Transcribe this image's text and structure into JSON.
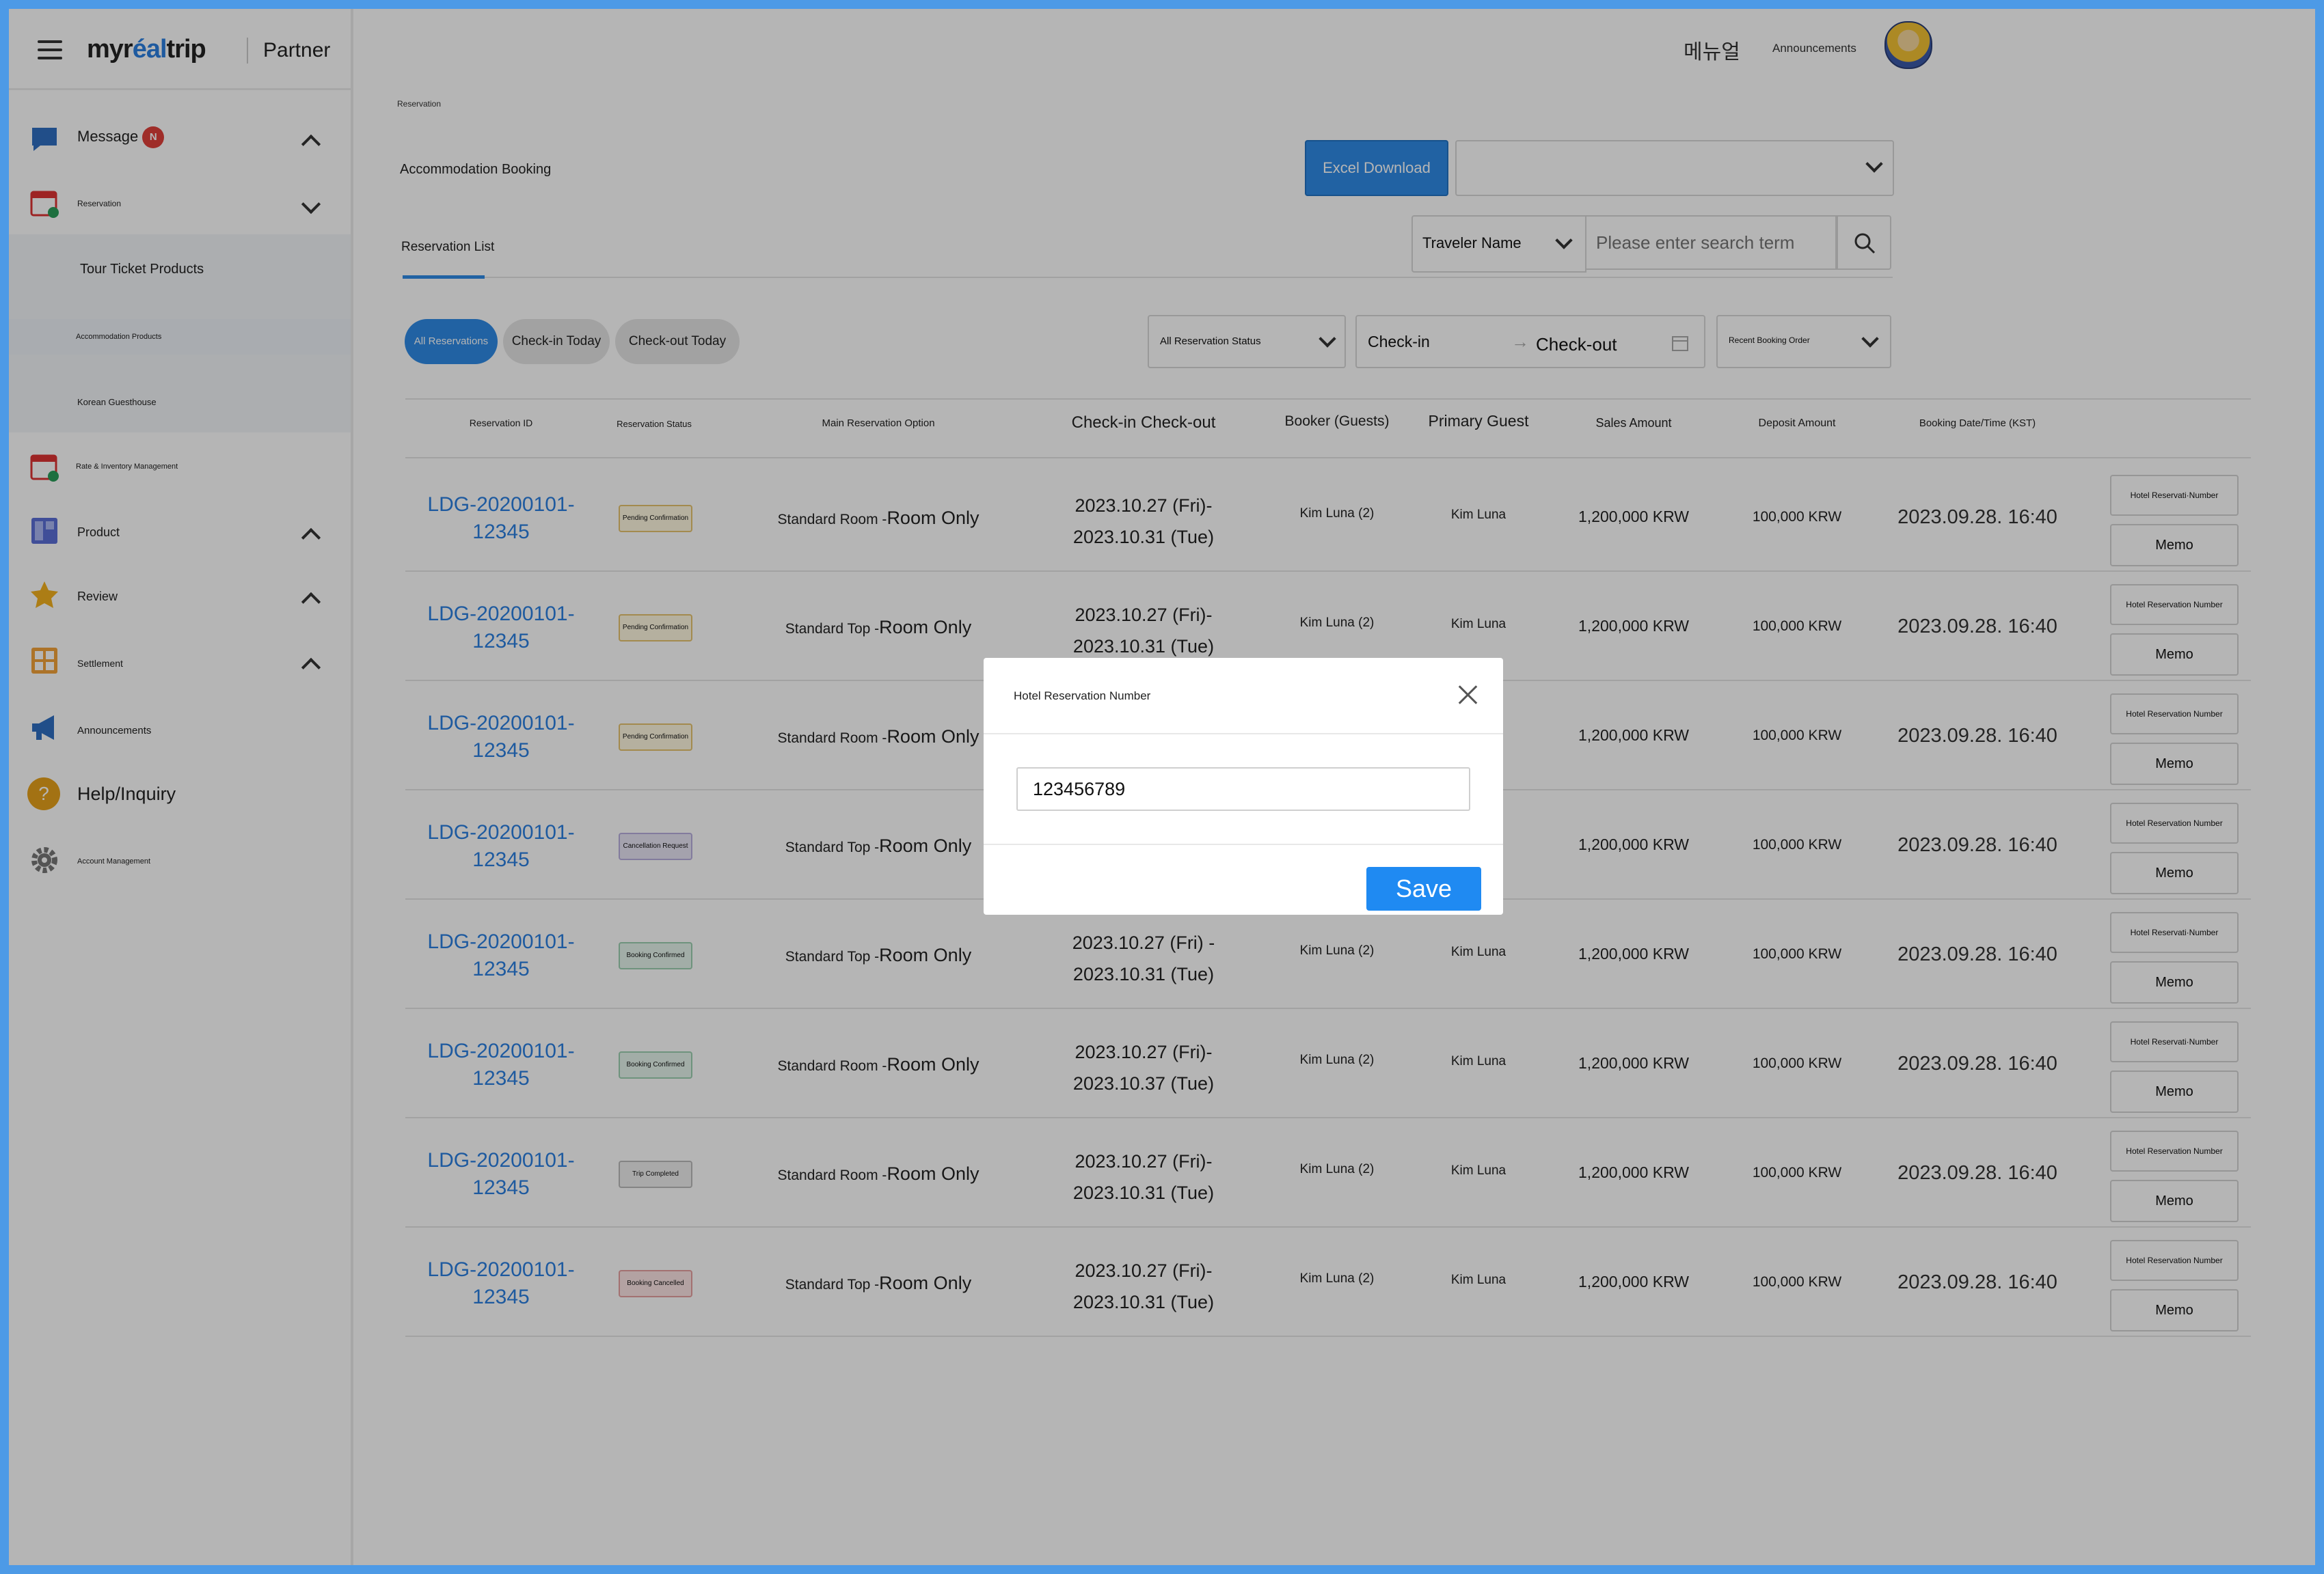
{
  "brand": {
    "logo_left": "myr",
    "logo_accent": "éal",
    "logo_right": "trip",
    "partner": "Partner"
  },
  "header": {
    "lang": "메뉴얼",
    "announcements": "Announcements"
  },
  "sidebar": {
    "message": "Message",
    "message_badge": "N",
    "reservation": "Reservation",
    "sub_items": [
      "Tour Ticket Products",
      "Accommodation Products",
      "Korean Guesthouse"
    ],
    "rate_inventory": "Rate & Inventory Management",
    "product": "Product",
    "review": "Review",
    "settlement": "Settlement",
    "announcements": "Announcements",
    "help": "Help/Inquiry",
    "account": "Account Management"
  },
  "page": {
    "breadcrumb": "Reservation",
    "title": "Accommodation Booking",
    "excel_download": "Excel Download",
    "tab": "Reservation List",
    "search_type": "Traveler Name",
    "search_placeholder": "Please enter search term"
  },
  "filters": {
    "pills": [
      "All Reservations",
      "Check-in Today",
      "Check-out Today"
    ],
    "status_select": "All Reservation Status",
    "checkin": "Check-in",
    "arrow": "→",
    "checkout": "Check-out",
    "sort_select": "Recent Booking Order"
  },
  "table": {
    "headers": [
      "Reservation ID",
      "Reservation Status",
      "Main Reservation Option",
      "Check-in Check-out",
      "Booker (Guests)",
      "Primary Guest",
      "Sales Amount",
      "Deposit Amount",
      "Booking Date/Time (KST)"
    ],
    "rows": [
      {
        "id1": "LDG-20200101-",
        "id2": "12345",
        "status": "Pending Confirmation",
        "opt_a": "Standard Room -",
        "opt_b": "Room Only",
        "d1": "2023.10.27 (Fri)-",
        "d2": "2023.10.31 (Tue)",
        "booker": "Kim Luna (2)",
        "guest": "Kim Luna",
        "sales": "1,200,000 KRW",
        "deposit": "100,000 KRW",
        "booked": "2023.09.28. 16:40",
        "hotel_btn": "Hotel Reservati·Number",
        "memo": "Memo"
      },
      {
        "id1": "LDG-20200101-",
        "id2": "12345",
        "status": "Pending Confirmation",
        "opt_a": "Standard Top -",
        "opt_b": "Room Only",
        "d1": "2023.10.27 (Fri)-",
        "d2": "2023.10.31 (Tue)",
        "booker": "Kim Luna (2)",
        "guest": "Kim Luna",
        "sales": "1,200,000 KRW",
        "deposit": "100,000 KRW",
        "booked": "2023.09.28. 16:40",
        "hotel_btn": "Hotel Reservation Number",
        "memo": "Memo"
      },
      {
        "id1": "LDG-20200101-",
        "id2": "12345",
        "status": "Pending Confirmation",
        "opt_a": "Standard Room -",
        "opt_b": "Room Only",
        "d1": "",
        "d2": "",
        "booker": "",
        "guest": "",
        "sales": "1,200,000 KRW",
        "deposit": "100,000 KRW",
        "booked": "2023.09.28. 16:40",
        "hotel_btn": "Hotel Reservation Number",
        "memo": "Memo"
      },
      {
        "id1": "LDG-20200101-",
        "id2": "12345",
        "status": "Cancellation Request",
        "opt_a": "Standard Top -",
        "opt_b": "Room Only",
        "d1": "",
        "d2": "",
        "booker": "",
        "guest": "",
        "sales": "1,200,000 KRW",
        "deposit": "100,000 KRW",
        "booked": "2023.09.28. 16:40",
        "hotel_btn": "Hotel Reservation Number",
        "memo": "Memo"
      },
      {
        "id1": "LDG-20200101-",
        "id2": "12345",
        "status": "Booking Confirmed",
        "opt_a": "Standard Top -",
        "opt_b": "Room Only",
        "d1": "2023.10.27 (Fri) -",
        "d2": "2023.10.31 (Tue)",
        "booker": "Kim Luna (2)",
        "guest": "Kim Luna",
        "sales": "1,200,000 KRW",
        "deposit": "100,000 KRW",
        "booked": "2023.09.28. 16:40",
        "hotel_btn": "Hotel Reservati·Number",
        "memo": "Memo"
      },
      {
        "id1": "LDG-20200101-",
        "id2": "12345",
        "status": "Booking Confirmed",
        "opt_a": "Standard Room -",
        "opt_b": "Room Only",
        "d1": "2023.10.27 (Fri)-",
        "d2": "2023.10.37 (Tue)",
        "booker": "Kim Luna (2)",
        "guest": "Kim Luna",
        "sales": "1,200,000 KRW",
        "deposit": "100,000 KRW",
        "booked": "2023.09.28. 16:40",
        "hotel_btn": "Hotel Reservati·Number",
        "memo": "Memo"
      },
      {
        "id1": "LDG-20200101-",
        "id2": "12345",
        "status": "Trip Completed",
        "opt_a": "Standard Room -",
        "opt_b": "Room Only",
        "d1": "2023.10.27 (Fri)-",
        "d2": "2023.10.31 (Tue)",
        "booker": "Kim Luna (2)",
        "guest": "Kim Luna",
        "sales": "1,200,000 KRW",
        "deposit": "100,000 KRW",
        "booked": "2023.09.28. 16:40",
        "hotel_btn": "Hotel Reservation Number",
        "memo": "Memo"
      },
      {
        "id1": "LDG-20200101-",
        "id2": "12345",
        "status": "Booking Cancelled",
        "opt_a": "Standard Top -",
        "opt_b": "Room Only",
        "d1": "2023.10.27 (Fri)-",
        "d2": "2023.10.31 (Tue)",
        "booker": "Kim Luna (2)",
        "guest": "Kim Luna",
        "sales": "1,200,000 KRW",
        "deposit": "100,000 KRW",
        "booked": "2023.09.28. 16:40",
        "hotel_btn": "Hotel Reservation Number",
        "memo": "Memo"
      }
    ]
  },
  "modal": {
    "title": "Hotel Reservation Number",
    "value": "123456789",
    "save": "Save"
  },
  "colors": {
    "accent": "#2f8be6",
    "link": "#2b7fe0",
    "badge": "#e0403a",
    "frame": "#4d9ae6"
  }
}
